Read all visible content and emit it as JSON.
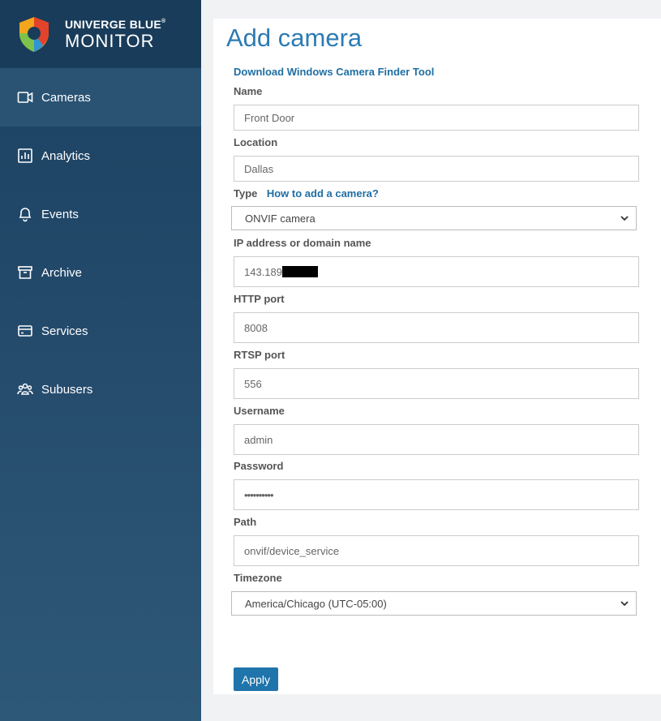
{
  "brand": {
    "top": "UNIVERGE BLUE",
    "reg": "®",
    "bottom": "MONITOR"
  },
  "sidebar": {
    "items": [
      {
        "label": "Cameras",
        "icon": "camera-icon",
        "active": true
      },
      {
        "label": "Analytics",
        "icon": "bar-chart-icon",
        "active": false
      },
      {
        "label": "Events",
        "icon": "bell-icon",
        "active": false
      },
      {
        "label": "Archive",
        "icon": "archive-icon",
        "active": false
      },
      {
        "label": "Services",
        "icon": "card-icon",
        "active": false
      },
      {
        "label": "Subusers",
        "icon": "users-icon",
        "active": false
      }
    ]
  },
  "page": {
    "title": "Add camera",
    "finder_link": "Download Windows Camera Finder Tool",
    "how_to_link": "How to add a camera?"
  },
  "form": {
    "name": {
      "label": "Name",
      "value": "Front Door"
    },
    "location": {
      "label": "Location",
      "value": "Dallas"
    },
    "type": {
      "label": "Type",
      "value": "ONVIF camera"
    },
    "ip": {
      "label": "IP address or domain name",
      "value": "143.189"
    },
    "http_port": {
      "label": "HTTP port",
      "value": "8008"
    },
    "rtsp_port": {
      "label": "RTSP port",
      "value": "556"
    },
    "username": {
      "label": "Username",
      "value": "admin"
    },
    "password": {
      "label": "Password",
      "value": "••••••••••"
    },
    "path": {
      "label": "Path",
      "value": "onvif/device_service"
    },
    "timezone": {
      "label": "Timezone",
      "value": "America/Chicago (UTC-05:00)"
    },
    "apply_label": "Apply"
  },
  "colors": {
    "accent": "#2c7bb3",
    "sidebar": "#1b4262",
    "button": "#1f74ab"
  }
}
